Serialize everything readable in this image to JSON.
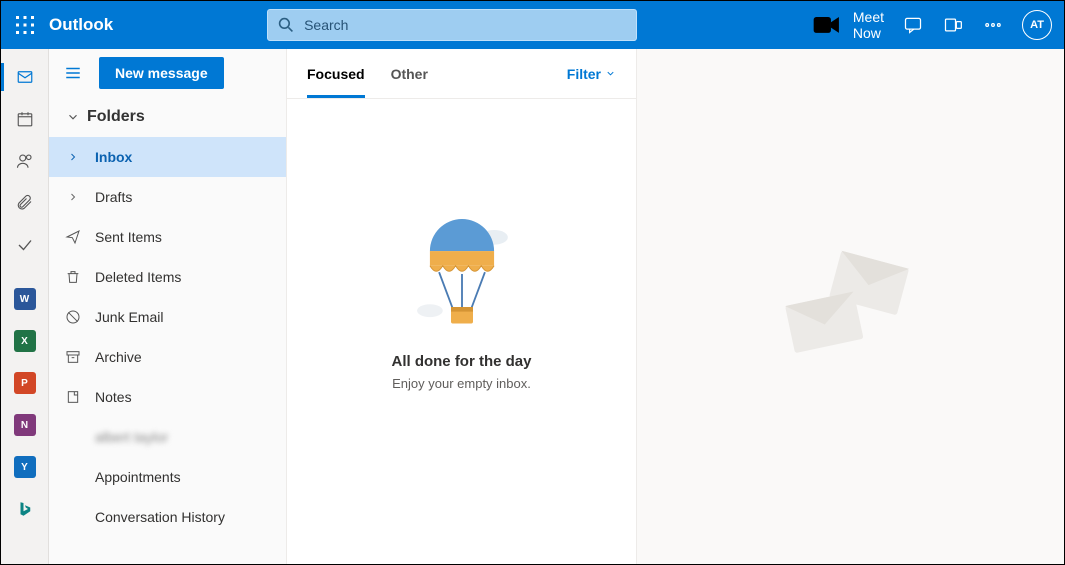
{
  "header": {
    "brand": "Outlook",
    "search_placeholder": "Search",
    "meet_now": "Meet Now",
    "avatar_initials": "AT"
  },
  "sidebar": {
    "new_message": "New message",
    "folders_label": "Folders",
    "items": [
      {
        "label": "Inbox"
      },
      {
        "label": "Drafts"
      },
      {
        "label": "Sent Items"
      },
      {
        "label": "Deleted Items"
      },
      {
        "label": "Junk Email"
      },
      {
        "label": "Archive"
      },
      {
        "label": "Notes"
      },
      {
        "label": "albert taylor"
      },
      {
        "label": "Appointments"
      },
      {
        "label": "Conversation History"
      }
    ]
  },
  "msglist": {
    "tab_focused": "Focused",
    "tab_other": "Other",
    "filter": "Filter",
    "empty_title": "All done for the day",
    "empty_sub": "Enjoy your empty inbox."
  }
}
